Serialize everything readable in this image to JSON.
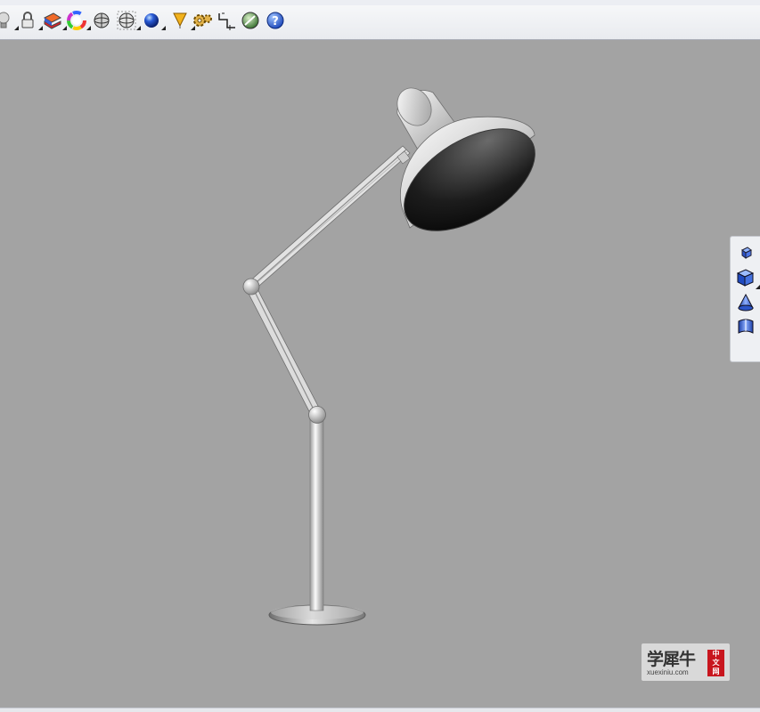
{
  "toolbar": {
    "buttons": [
      {
        "icon": "lightbulb-icon",
        "has_flyout": true
      },
      {
        "icon": "lock-icon",
        "has_flyout": true
      },
      {
        "icon": "layer-color-icon",
        "has_flyout": true
      },
      {
        "icon": "color-wheel-icon",
        "has_flyout": true
      },
      {
        "icon": "sphere-wireframe-icon",
        "has_flyout": false
      },
      {
        "icon": "sphere-ghosted-icon",
        "has_flyout": true
      },
      {
        "icon": "sphere-render-icon",
        "has_flyout": true
      },
      {
        "icon": "light-cone-icon",
        "has_flyout": true
      },
      {
        "icon": "gear-settings-icon",
        "has_flyout": false
      },
      {
        "icon": "dimension-icon",
        "has_flyout": false
      },
      {
        "icon": "globe-render-icon",
        "has_flyout": false
      },
      {
        "icon": "help-icon",
        "has_flyout": false
      }
    ]
  },
  "side_toolbar": {
    "buttons": [
      {
        "icon": "box-small-icon"
      },
      {
        "icon": "box-solid-icon"
      },
      {
        "icon": "cone-icon"
      },
      {
        "icon": "cylinder-surface-icon"
      }
    ]
  },
  "viewport": {
    "background": "#a3a3a3",
    "model": "desk-lamp"
  },
  "watermark": {
    "title": "学犀牛",
    "url": "xuexiniu.com",
    "seal_text": "中文网",
    "seal_color": "#c8161e"
  }
}
